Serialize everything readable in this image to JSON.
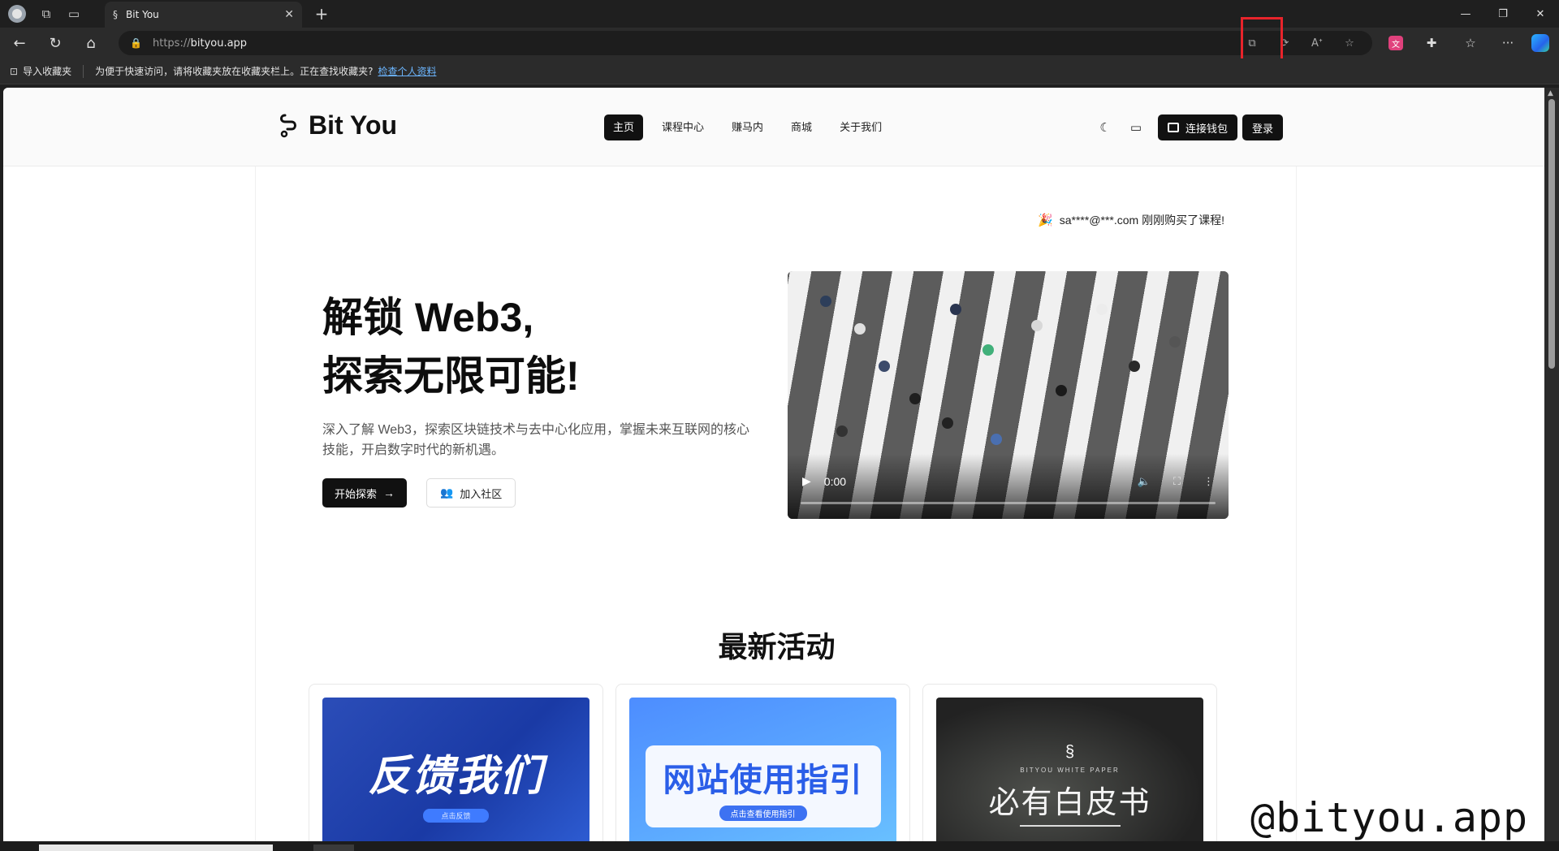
{
  "browser": {
    "tab_title": "Bit You",
    "new_tab_symbol": "+",
    "url_protocol": "https://",
    "url_host": "bityou.app",
    "favorites_bar": {
      "import_label": "导入收藏夹",
      "hint_text": "为便于快速访问，请将收藏夹放在收藏夹栏上。正在查找收藏夹?",
      "link_text": "检查个人资料"
    }
  },
  "site": {
    "brand": "Bit You",
    "nav": [
      {
        "label": "主页",
        "active": true
      },
      {
        "label": "课程中心",
        "active": false
      },
      {
        "label": "赚马内",
        "active": false
      },
      {
        "label": "商城",
        "active": false
      },
      {
        "label": "关于我们",
        "active": false
      }
    ],
    "connect_wallet": "连接钱包",
    "login": "登录"
  },
  "notice": {
    "text": "sa****@***.com 刚刚购买了课程!"
  },
  "hero": {
    "title_line1": "解锁 Web3,",
    "title_line2": "探索无限可能!",
    "description": "深入了解 Web3，探索区块链技术与去中心化应用，掌握未来互联网的核心技能，开启数字时代的新机遇。",
    "primary_button": "开始探索",
    "secondary_button": "加入社区"
  },
  "video": {
    "time": "0:00",
    "progress": 0
  },
  "activities": {
    "title": "最新活动",
    "cards": [
      {
        "headline": "反馈我们",
        "sub": "点击反馈"
      },
      {
        "headline": "网站使用指引",
        "sub": "点击查看使用指引"
      },
      {
        "headline": "必有白皮书",
        "sub": "BITYOU WHITE PAPER"
      }
    ]
  },
  "watermark": "@bityou.app",
  "icons": {
    "back": "arrow-left-icon",
    "refresh": "refresh-icon",
    "home": "home-icon",
    "lock": "lock-icon",
    "theme": "moon-icon",
    "message": "message-icon",
    "wallet": "wallet-icon",
    "user": "users-icon"
  },
  "colors": {
    "highlight_box": "#e8242b",
    "primary": "#111111",
    "link": "#6cb6ff"
  }
}
